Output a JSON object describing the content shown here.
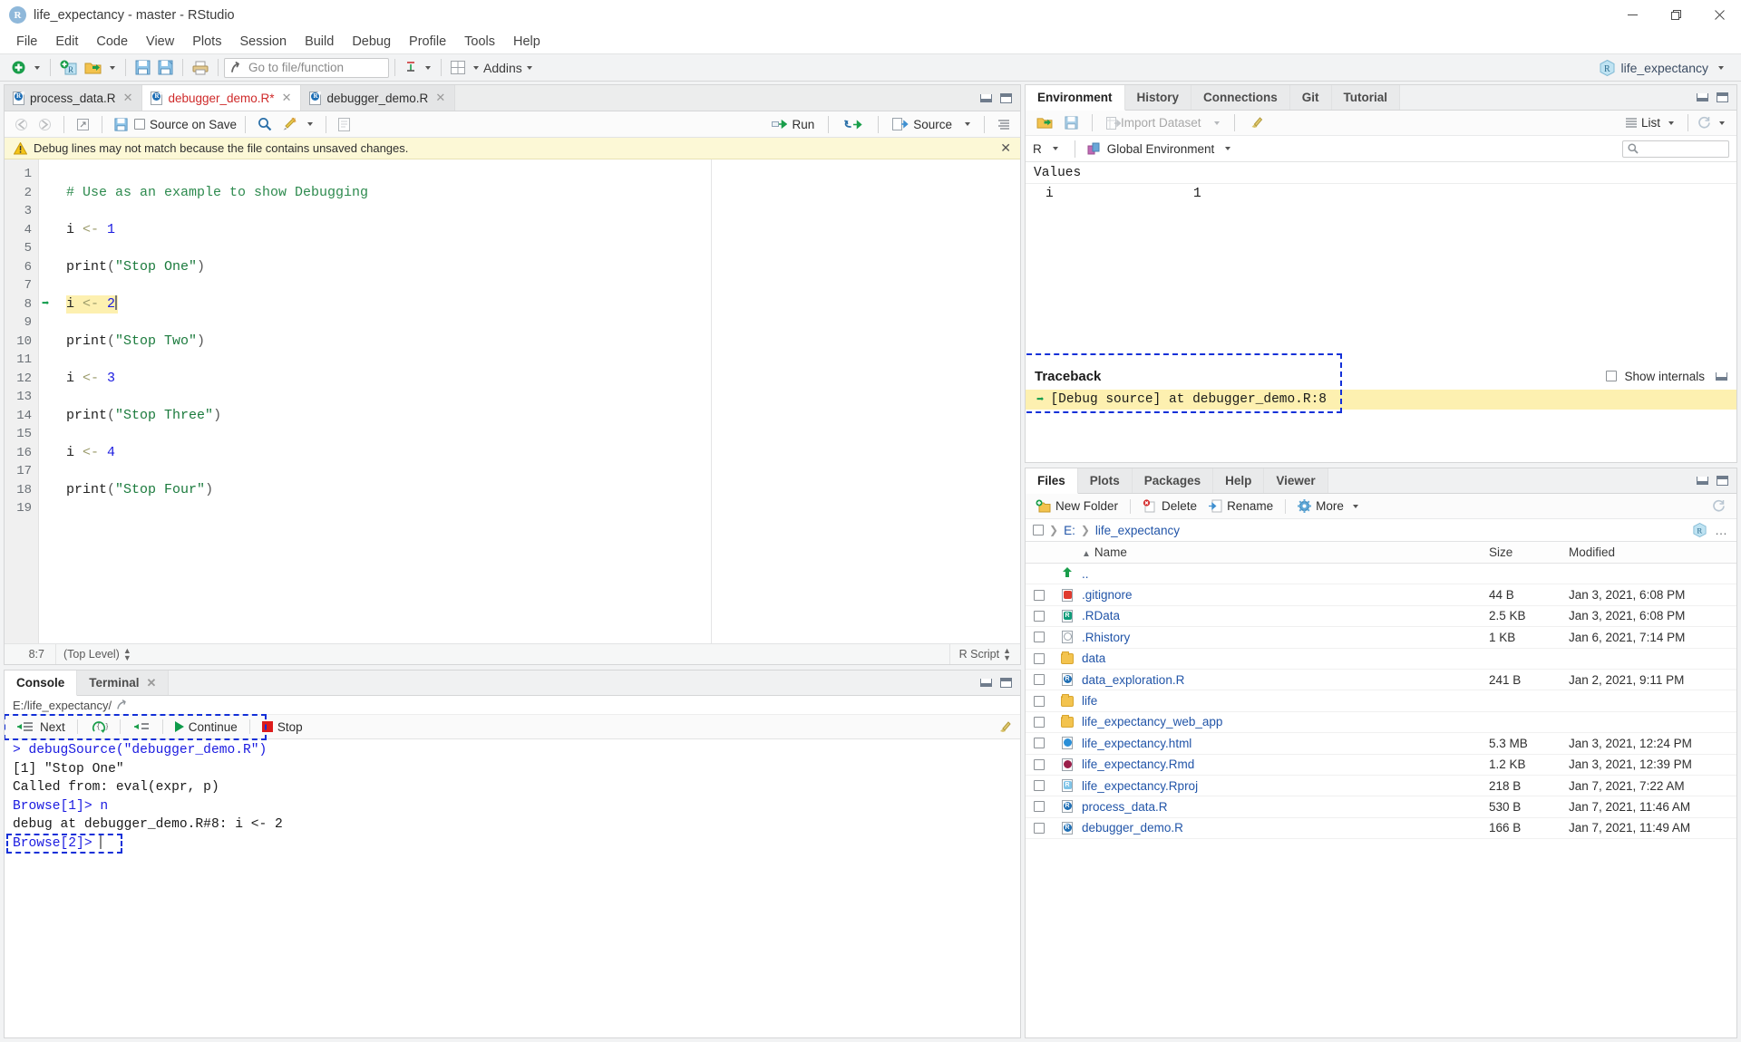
{
  "window": {
    "title": "life_expectancy - master - RStudio",
    "app_icon": "R",
    "minimize": "—",
    "maximize": "❐",
    "close": "✕"
  },
  "menubar": [
    "File",
    "Edit",
    "Code",
    "View",
    "Plots",
    "Session",
    "Build",
    "Debug",
    "Profile",
    "Tools",
    "Help"
  ],
  "toolbar": {
    "goto_placeholder": "Go to file/function",
    "addins_label": "Addins",
    "project_name": "life_expectancy"
  },
  "source": {
    "tabs": [
      {
        "label": "process_data.R",
        "modified": false,
        "active": false
      },
      {
        "label": "debugger_demo.R*",
        "modified": true,
        "active": true
      },
      {
        "label": "debugger_demo.R",
        "modified": false,
        "active": false
      }
    ],
    "toolbar": {
      "source_on_save": "Source on Save",
      "run_label": "Run",
      "source_label": "Source"
    },
    "warning": "Debug lines may not match because the file contains unsaved changes.",
    "lines": [
      {
        "n": 1,
        "tokens": []
      },
      {
        "n": 2,
        "tokens": [
          {
            "t": "# Use as an example to show Debugging",
            "c": "cmt"
          }
        ]
      },
      {
        "n": 3,
        "tokens": []
      },
      {
        "n": 4,
        "tokens": [
          {
            "t": "i ",
            "c": "fn"
          },
          {
            "t": "<- ",
            "c": "op"
          },
          {
            "t": "1",
            "c": "num"
          }
        ]
      },
      {
        "n": 5,
        "tokens": []
      },
      {
        "n": 6,
        "tokens": [
          {
            "t": "print",
            "c": "fn"
          },
          {
            "t": "(",
            "c": "par"
          },
          {
            "t": "\"Stop One\"",
            "c": "str"
          },
          {
            "t": ")",
            "c": "par"
          }
        ]
      },
      {
        "n": 7,
        "tokens": []
      },
      {
        "n": 8,
        "tokens": [
          {
            "t": "i ",
            "c": "fn"
          },
          {
            "t": "<- ",
            "c": "op"
          },
          {
            "t": "2",
            "c": "num"
          }
        ],
        "highlight": true,
        "debug_arrow": true,
        "cursor": true
      },
      {
        "n": 9,
        "tokens": []
      },
      {
        "n": 10,
        "tokens": [
          {
            "t": "print",
            "c": "fn"
          },
          {
            "t": "(",
            "c": "par"
          },
          {
            "t": "\"Stop Two\"",
            "c": "str"
          },
          {
            "t": ")",
            "c": "par"
          }
        ]
      },
      {
        "n": 11,
        "tokens": []
      },
      {
        "n": 12,
        "tokens": [
          {
            "t": "i ",
            "c": "fn"
          },
          {
            "t": "<- ",
            "c": "op"
          },
          {
            "t": "3",
            "c": "num"
          }
        ]
      },
      {
        "n": 13,
        "tokens": []
      },
      {
        "n": 14,
        "tokens": [
          {
            "t": "print",
            "c": "fn"
          },
          {
            "t": "(",
            "c": "par"
          },
          {
            "t": "\"Stop Three\"",
            "c": "str"
          },
          {
            "t": ")",
            "c": "par"
          }
        ]
      },
      {
        "n": 15,
        "tokens": []
      },
      {
        "n": 16,
        "tokens": [
          {
            "t": "i ",
            "c": "fn"
          },
          {
            "t": "<- ",
            "c": "op"
          },
          {
            "t": "4",
            "c": "num"
          }
        ]
      },
      {
        "n": 17,
        "tokens": []
      },
      {
        "n": 18,
        "tokens": [
          {
            "t": "print",
            "c": "fn"
          },
          {
            "t": "(",
            "c": "par"
          },
          {
            "t": "\"Stop Four\"",
            "c": "str"
          },
          {
            "t": ")",
            "c": "par"
          }
        ]
      },
      {
        "n": 19,
        "tokens": []
      }
    ],
    "status": {
      "cursor_position": "8:7",
      "scope": "(Top Level)",
      "language": "R Script"
    }
  },
  "console": {
    "tabs": [
      {
        "label": "Console",
        "active": true,
        "closable": false
      },
      {
        "label": "Terminal",
        "active": false,
        "closable": true
      }
    ],
    "working_dir": "E:/life_expectancy/",
    "debug_buttons": [
      {
        "label": "Next",
        "icon": "step-next-icon"
      },
      {
        "label": "",
        "icon": "step-into-icon"
      },
      {
        "label": "",
        "icon": "step-out-icon"
      },
      {
        "label": "Continue",
        "icon": "continue-icon"
      },
      {
        "label": "Stop",
        "icon": "stop-icon"
      }
    ],
    "output": [
      {
        "text": "> debugSource(\"debugger_demo.R\")",
        "style": "cmd"
      },
      {
        "text": "[1] \"Stop One\"",
        "style": "out"
      },
      {
        "text": "Called from: eval(expr, p)",
        "style": "out"
      },
      {
        "text": "Browse[1]> n",
        "style": "cmd"
      },
      {
        "text": "debug at debugger_demo.R#8: i <- 2",
        "style": "out"
      },
      {
        "text": "Browse[2]> ",
        "style": "cmd",
        "prompt": true
      }
    ]
  },
  "environment": {
    "tabs": [
      {
        "label": "Environment",
        "active": true
      },
      {
        "label": "History",
        "active": false
      },
      {
        "label": "Connections",
        "active": false
      },
      {
        "label": "Git",
        "active": false
      },
      {
        "label": "Tutorial",
        "active": false
      }
    ],
    "toolbar": {
      "import_dataset": "Import Dataset",
      "view_mode": "List",
      "language": "R",
      "scope": "Global Environment",
      "search_placeholder": ""
    },
    "section_title": "Values",
    "rows": [
      {
        "name": "i",
        "value": "1"
      }
    ]
  },
  "traceback": {
    "title": "Traceback",
    "show_internals_label": "Show internals",
    "rows": [
      {
        "text": "[Debug source] at debugger_demo.R:8",
        "current": true
      }
    ]
  },
  "files": {
    "tabs": [
      {
        "label": "Files",
        "active": true
      },
      {
        "label": "Plots",
        "active": false
      },
      {
        "label": "Packages",
        "active": false
      },
      {
        "label": "Help",
        "active": false
      },
      {
        "label": "Viewer",
        "active": false
      }
    ],
    "toolbar": {
      "new_folder": "New Folder",
      "delete": "Delete",
      "rename": "Rename",
      "more": "More"
    },
    "breadcrumbs": [
      "E:",
      "life_expectancy"
    ],
    "columns": {
      "name": "Name",
      "size": "Size",
      "modified": "Modified",
      "sort_indicator": "▲"
    },
    "rows": [
      {
        "name": "..",
        "size": "",
        "modified": "",
        "icon": "up-arrow-icon",
        "checkbox": false
      },
      {
        "name": ".gitignore",
        "size": "44 B",
        "modified": "Jan 3, 2021, 6:08 PM",
        "icon": "git-file-icon",
        "checkbox": true
      },
      {
        "name": ".RData",
        "size": "2.5 KB",
        "modified": "Jan 3, 2021, 6:08 PM",
        "icon": "rdata-file-icon",
        "checkbox": true
      },
      {
        "name": ".Rhistory",
        "size": "1 KB",
        "modified": "Jan 6, 2021, 7:14 PM",
        "icon": "history-file-icon",
        "checkbox": true
      },
      {
        "name": "data",
        "size": "",
        "modified": "",
        "icon": "folder-icon",
        "checkbox": true
      },
      {
        "name": "data_exploration.R",
        "size": "241 B",
        "modified": "Jan 2, 2021, 9:11 PM",
        "icon": "r-file-icon",
        "checkbox": true
      },
      {
        "name": "life",
        "size": "",
        "modified": "",
        "icon": "folder-icon",
        "checkbox": true
      },
      {
        "name": "life_expectancy_web_app",
        "size": "",
        "modified": "",
        "icon": "folder-icon",
        "checkbox": true
      },
      {
        "name": "life_expectancy.html",
        "size": "5.3 MB",
        "modified": "Jan 3, 2021, 12:24 PM",
        "icon": "html-file-icon",
        "checkbox": true
      },
      {
        "name": "life_expectancy.Rmd",
        "size": "1.2 KB",
        "modified": "Jan 3, 2021, 12:39 PM",
        "icon": "rmd-file-icon",
        "checkbox": true
      },
      {
        "name": "life_expectancy.Rproj",
        "size": "218 B",
        "modified": "Jan 7, 2021, 7:22 AM",
        "icon": "rproj-file-icon",
        "checkbox": true
      },
      {
        "name": "process_data.R",
        "size": "530 B",
        "modified": "Jan 7, 2021, 11:46 AM",
        "icon": "r-file-icon",
        "checkbox": true
      },
      {
        "name": "debugger_demo.R",
        "size": "166 B",
        "modified": "Jan 7, 2021, 11:49 AM",
        "icon": "r-file-icon",
        "checkbox": true
      }
    ]
  },
  "colors": {
    "highlight": "#fdf0b0",
    "warning_bg": "#fcf8d6",
    "accent_blue": "#2255a8",
    "debug_arrow": "#0f9b4a",
    "stop_red": "#dd1c1c",
    "annotation": "#1330d8"
  }
}
